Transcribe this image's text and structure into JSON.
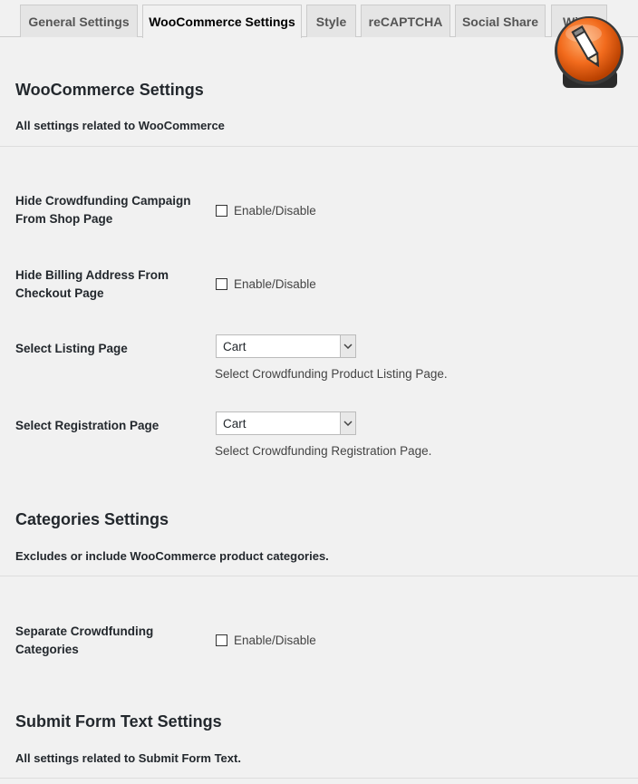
{
  "tabs": [
    {
      "label": "General Settings",
      "active": false
    },
    {
      "label": "WooCommerce Settings",
      "active": true
    },
    {
      "label": "Style",
      "active": false
    },
    {
      "label": "reCAPTCHA",
      "active": false
    },
    {
      "label": "Social Share",
      "active": false
    },
    {
      "label": "Wi",
      "active": false
    }
  ],
  "woo": {
    "title": "WooCommerce Settings",
    "description": "All settings related to WooCommerce",
    "hide_campaign": {
      "label": "Hide Crowdfunding Campaign From Shop Page",
      "checkbox_label": "Enable/Disable",
      "checked": false
    },
    "hide_billing": {
      "label": "Hide Billing Address From Checkout Page",
      "checkbox_label": "Enable/Disable",
      "checked": false
    },
    "listing_page": {
      "label": "Select Listing Page",
      "value": "Cart",
      "help": "Select Crowdfunding Product Listing Page."
    },
    "registration_page": {
      "label": "Select Registration Page",
      "value": "Cart",
      "help": "Select Crowdfunding Registration Page."
    }
  },
  "categories": {
    "title": "Categories Settings",
    "description": "Excludes or include WooCommerce product categories.",
    "separate": {
      "label": "Separate Crowdfunding Categories",
      "checkbox_label": "Enable/Disable",
      "checked": false
    }
  },
  "submit_form": {
    "title": "Submit Form Text Settings",
    "description": "All settings related to Submit Form Text."
  },
  "colors": {
    "accent_orange": "#f26b1d",
    "background": "#f1f1f1"
  },
  "icons": {
    "overlay": "pencil-edit-icon",
    "dropdown": "chevron-down-icon"
  }
}
